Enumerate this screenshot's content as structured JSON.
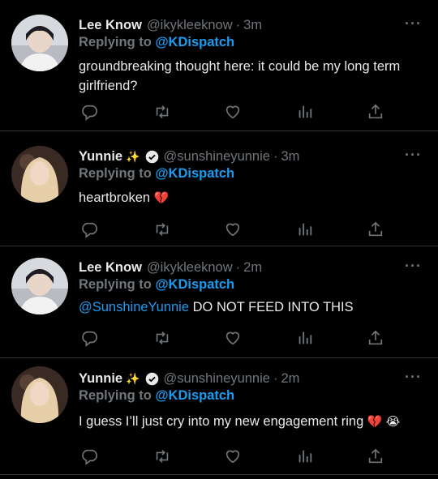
{
  "tweets": [
    {
      "name": "Lee Know",
      "handle": "@ikykleeknow",
      "time": "3m",
      "replying_label": "Replying to",
      "replying_to": "@KDispatch",
      "text_before": "",
      "text_mention": "",
      "text": "groundbreaking thought here: it could be my long term girlfriend?",
      "emoji": ""
    },
    {
      "name": "Yunnie",
      "name_emoji": "✨",
      "handle": "@sunshineyunnie",
      "time": "3m",
      "replying_label": "Replying to",
      "replying_to": "@KDispatch",
      "text_mention": "",
      "text": "heartbroken",
      "emoji": "💔"
    },
    {
      "name": "Lee Know",
      "handle": "@ikykleeknow",
      "time": "2m",
      "replying_label": "Replying to",
      "replying_to": "@KDispatch",
      "text_mention": "@SunshineYunnie",
      "text": "DO NOT FEED INTO THIS",
      "emoji": ""
    },
    {
      "name": "Yunnie",
      "name_emoji": "✨",
      "handle": "@sunshineyunnie",
      "time": "2m",
      "replying_label": "Replying to",
      "replying_to": "@KDispatch",
      "text_mention": "",
      "text": "I guess I’ll just cry into my new engagement ring",
      "emoji": "💔 😭"
    }
  ],
  "colors": {
    "background": "#000000",
    "text": "#e7e9ea",
    "muted": "#71767b",
    "accent": "#1d9bf0",
    "divider": "#2f3336"
  },
  "icons": [
    "reply-icon",
    "retweet-icon",
    "like-icon",
    "analytics-icon",
    "share-icon",
    "more-icon",
    "verified-icon"
  ]
}
